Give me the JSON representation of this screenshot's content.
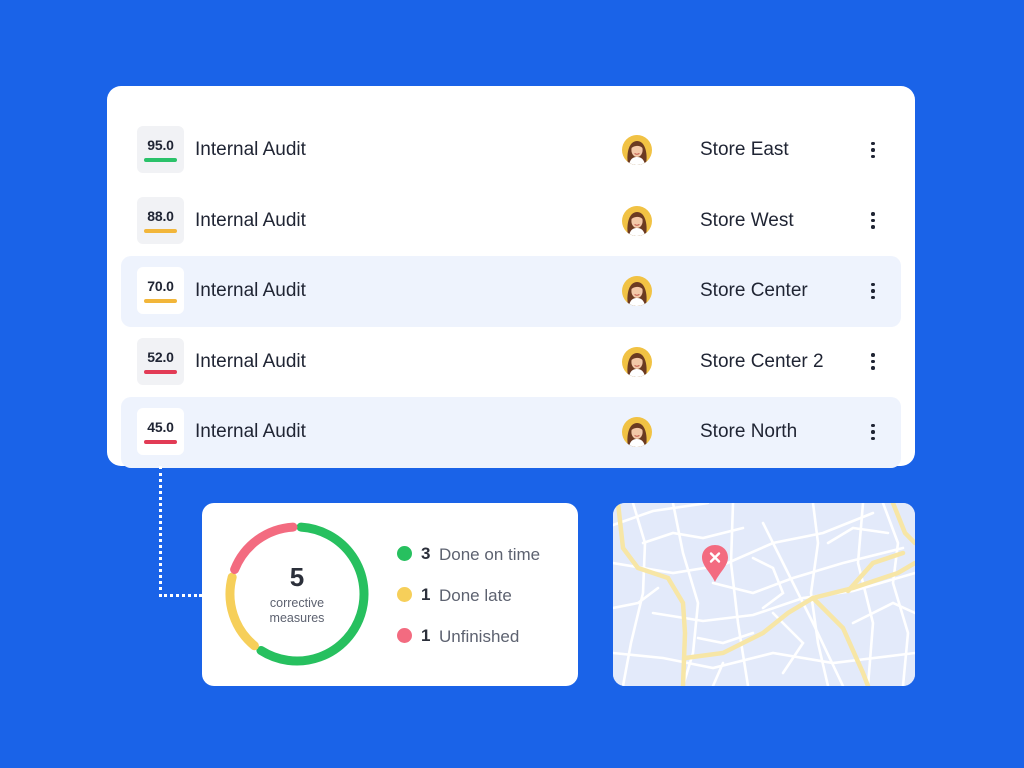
{
  "audits": [
    {
      "score": "95.0",
      "score_color": "#2bc26a",
      "title": "Internal Audit",
      "store": "Store East",
      "highlighted": false
    },
    {
      "score": "88.0",
      "score_color": "#f2b63a",
      "title": "Internal Audit",
      "store": "Store West",
      "highlighted": false
    },
    {
      "score": "70.0",
      "score_color": "#f2b63a",
      "title": "Internal Audit",
      "store": "Store Center",
      "highlighted": true
    },
    {
      "score": "52.0",
      "score_color": "#e23b55",
      "title": "Internal Audit",
      "store": "Store Center 2",
      "highlighted": false
    },
    {
      "score": "45.0",
      "score_color": "#e23b55",
      "title": "Internal Audit",
      "store": "Store North",
      "highlighted": true
    }
  ],
  "measures": {
    "total": "5",
    "label_line1": "corrective",
    "label_line2": "measures",
    "legend": [
      {
        "count": "3",
        "label": "Done on time",
        "color": "#27c05f"
      },
      {
        "count": "1",
        "label": "Done late",
        "color": "#f6cf5a"
      },
      {
        "count": "1",
        "label": "Unfinished",
        "color": "#f36b80"
      }
    ]
  },
  "map": {
    "pin_icon": "location-pin-icon",
    "pin_color": "#f36b80",
    "road_color": "#f7e6a6",
    "street_color": "#ffffff",
    "background_color": "#e3eafa"
  },
  "colors": {
    "page_background": "#1a63e8",
    "highlight_row": "#eef3fd"
  }
}
